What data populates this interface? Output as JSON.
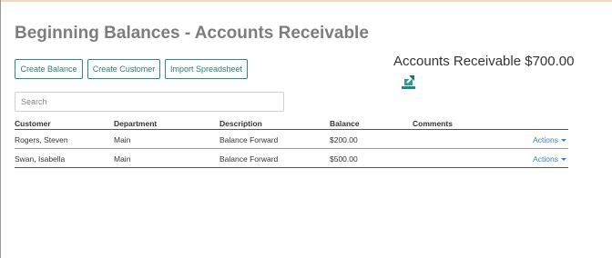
{
  "page": {
    "title": "Beginning Balances - Accounts Receivable"
  },
  "toolbar": {
    "create_balance_label": "Create Balance",
    "create_customer_label": "Create Customer",
    "import_spreadsheet_label": "Import Spreadsheet"
  },
  "summary": {
    "accounts_receivable_text": "Accounts Receivable $700.00",
    "export_icon": "export-icon"
  },
  "search": {
    "placeholder": "Search",
    "value": ""
  },
  "table": {
    "headers": {
      "customer": "Customer",
      "department": "Department",
      "description": "Description",
      "balance": "Balance",
      "comments": "Comments"
    },
    "rows": [
      {
        "customer": "Rogers, Steven",
        "department": "Main",
        "description": "Balance Forward",
        "balance": "$200.00",
        "comments": "",
        "actions": "Actions"
      },
      {
        "customer": "Swan, Isabella",
        "department": "Main",
        "description": "Balance Forward",
        "balance": "$500.00",
        "comments": "",
        "actions": "Actions"
      }
    ]
  },
  "colors": {
    "accent": "#2e8b7a",
    "link": "#3a7fc4",
    "title": "#7d7d7d",
    "top_border": "#f3d7bf"
  }
}
